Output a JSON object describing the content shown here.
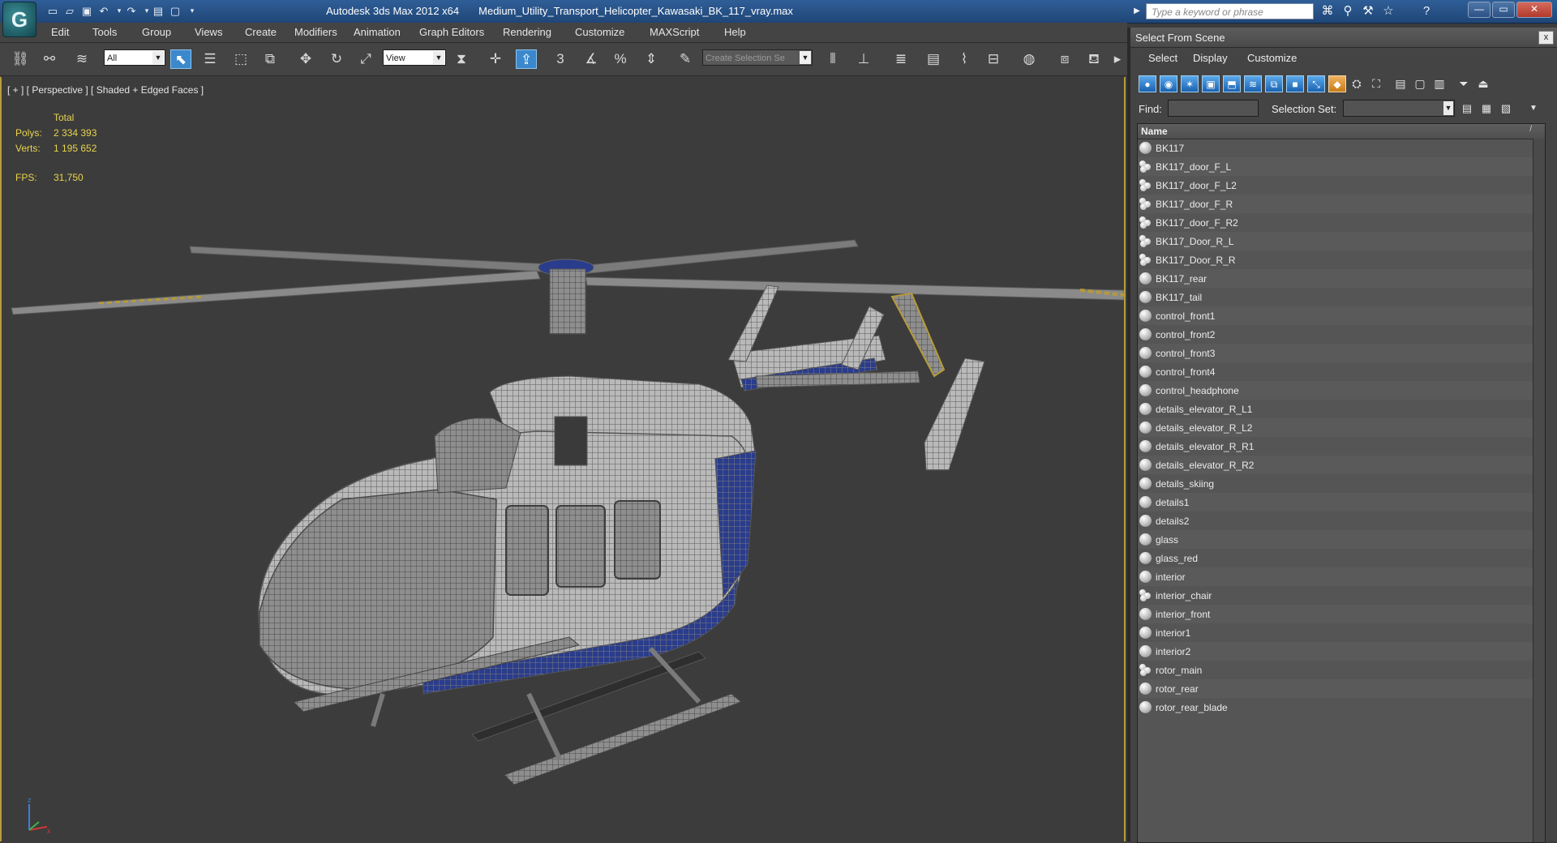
{
  "window": {
    "app_title": "Autodesk 3ds Max  2012 x64",
    "file_title": "Medium_Utility_Transport_Helicopter_Kawasaki_BK_117_vray.max",
    "logo_glyph": "G",
    "help_search_placeholder": "Type a keyword or phrase"
  },
  "menu": [
    "Edit",
    "Tools",
    "Group",
    "Views",
    "Create",
    "Modifiers",
    "Animation",
    "Graph Editors",
    "Rendering",
    "Customize",
    "MAXScript",
    "Help"
  ],
  "toolbar": {
    "selection_filter": "All",
    "ref_coord_system": "View",
    "named_selection_set": "Create Selection Se",
    "snap_label": "3",
    "percent_label": "%"
  },
  "viewport": {
    "label": "[ + ] [ Perspective ] [ Shaded + Edged Faces ]",
    "stats": {
      "header": "Total",
      "polys_label": "Polys:",
      "polys_value": "2 334 393",
      "verts_label": "Verts:",
      "verts_value": "1 195 652",
      "fps_label": "FPS:",
      "fps_value": "31,750"
    },
    "axis_labels": {
      "z": "z",
      "x": "x"
    }
  },
  "select_from_scene": {
    "title": "Select From Scene",
    "close_glyph": "x",
    "menu": [
      "Select",
      "Display",
      "Customize"
    ],
    "find_label": "Find:",
    "find_value": "",
    "selection_set_label": "Selection Set:",
    "column_header": "Name",
    "sort_indicator": "/",
    "items": [
      {
        "name": "BK117",
        "icon": "sphere"
      },
      {
        "name": "BK117_door_F_L",
        "icon": "group"
      },
      {
        "name": "BK117_door_F_L2",
        "icon": "group"
      },
      {
        "name": "BK117_door_F_R",
        "icon": "group"
      },
      {
        "name": "BK117_door_F_R2",
        "icon": "group"
      },
      {
        "name": "BK117_Door_R_L",
        "icon": "group"
      },
      {
        "name": "BK117_Door_R_R",
        "icon": "group"
      },
      {
        "name": "BK117_rear",
        "icon": "sphere"
      },
      {
        "name": "BK117_tail",
        "icon": "sphere"
      },
      {
        "name": "control_front1",
        "icon": "sphere"
      },
      {
        "name": "control_front2",
        "icon": "sphere"
      },
      {
        "name": "control_front3",
        "icon": "sphere"
      },
      {
        "name": "control_front4",
        "icon": "sphere"
      },
      {
        "name": "control_headphone",
        "icon": "sphere"
      },
      {
        "name": "details_elevator_R_L1",
        "icon": "sphere"
      },
      {
        "name": "details_elevator_R_L2",
        "icon": "sphere"
      },
      {
        "name": "details_elevator_R_R1",
        "icon": "sphere"
      },
      {
        "name": "details_elevator_R_R2",
        "icon": "sphere"
      },
      {
        "name": "details_skiing",
        "icon": "sphere"
      },
      {
        "name": "details1",
        "icon": "sphere"
      },
      {
        "name": "details2",
        "icon": "sphere"
      },
      {
        "name": "glass",
        "icon": "sphere"
      },
      {
        "name": "glass_red",
        "icon": "sphere"
      },
      {
        "name": "interior",
        "icon": "sphere"
      },
      {
        "name": "interior_chair",
        "icon": "group"
      },
      {
        "name": "interior_front",
        "icon": "sphere"
      },
      {
        "name": "interior1",
        "icon": "sphere"
      },
      {
        "name": "interior2",
        "icon": "sphere"
      },
      {
        "name": "rotor_main",
        "icon": "group"
      },
      {
        "name": "rotor_rear",
        "icon": "sphere"
      },
      {
        "name": "rotor_rear_blade",
        "icon": "sphere"
      }
    ]
  },
  "colors": {
    "title_bar": "#2f5e97",
    "ui_background": "#444444",
    "viewport_background": "#3c3c3c",
    "active_viewport_border": "#b89d3b",
    "stats_text": "#e8d44d",
    "active_tool": "#3c88cc"
  }
}
